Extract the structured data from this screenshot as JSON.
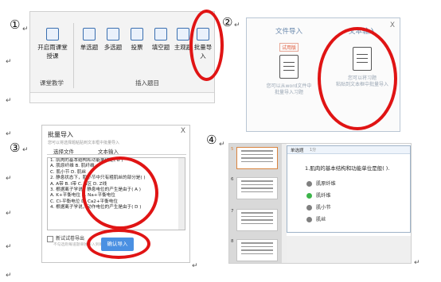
{
  "labels": {
    "n1": "①",
    "n2": "②",
    "n3": "③",
    "n4": "④"
  },
  "para_mark": "↵",
  "panel1": {
    "buttons": [
      "开启雨课堂授课",
      "单选题",
      "多选题",
      "投票",
      "填空题",
      "主观题",
      "批量导入"
    ],
    "groups": [
      "课堂教学",
      "插入题目"
    ],
    "icons": [
      "presentation-icon",
      "single-choice-icon",
      "multi-choice-icon",
      "vote-chart-icon",
      "fill-blank-icon",
      "subjective-icon",
      "batch-import-icon"
    ]
  },
  "panel2": {
    "close": "X",
    "file_import": {
      "title": "文件导入",
      "tag": "试用版",
      "desc1": "您可以从word文件中",
      "desc2": "批量导入习题"
    },
    "text_input": {
      "title": "文本输入",
      "desc1": "您可以将习题",
      "desc2": "粘贴到文本框中批量导入"
    }
  },
  "panel3": {
    "title": "批量导入",
    "close": "X",
    "sub": "您可以将选择题粘贴到文本框中批量导入",
    "tabs": [
      "选择文件",
      "文本输入"
    ],
    "lines": [
      "1.  肌肉的基本结构和功能单位是( B )",
      "    A.  肌原纤维          B.  肌纤维",
      "    C.  肌小节            D.  肌丝",
      "2.  静息状态下，肌小节中只有粗肌丝的部分是(    )",
      "    A.  A带     B.  I带     C.  H区     D.  Z线",
      "3.  根据离子学说，静息电位的产生是由于(  A  )",
      "    A.  K+平衡电位          B.  Na+平衡电位",
      "    C.  Cl-平衡电位         D.  Ca2+平衡电位",
      "4.  根据离子学说，动作电位的产生是由于(  D  )"
    ],
    "checkbox_label": "新试试卷导出",
    "hint": "不勾选则每道题单独导入到新的幻灯片中",
    "ok": "确认导入"
  },
  "panel4": {
    "slides": [
      "5",
      "6",
      "7",
      "8"
    ],
    "card_type": "单选题",
    "card_page": "1分",
    "question": "1.肌肉的基本结构和功能单位是般(    ).",
    "options": [
      {
        "key": "A",
        "text": "肌原纤维",
        "correct": false
      },
      {
        "key": "B",
        "text": "肌纤维",
        "correct": true
      },
      {
        "key": "C",
        "text": "肌小节",
        "correct": false
      },
      {
        "key": "D",
        "text": "肌丝",
        "correct": false
      }
    ]
  }
}
